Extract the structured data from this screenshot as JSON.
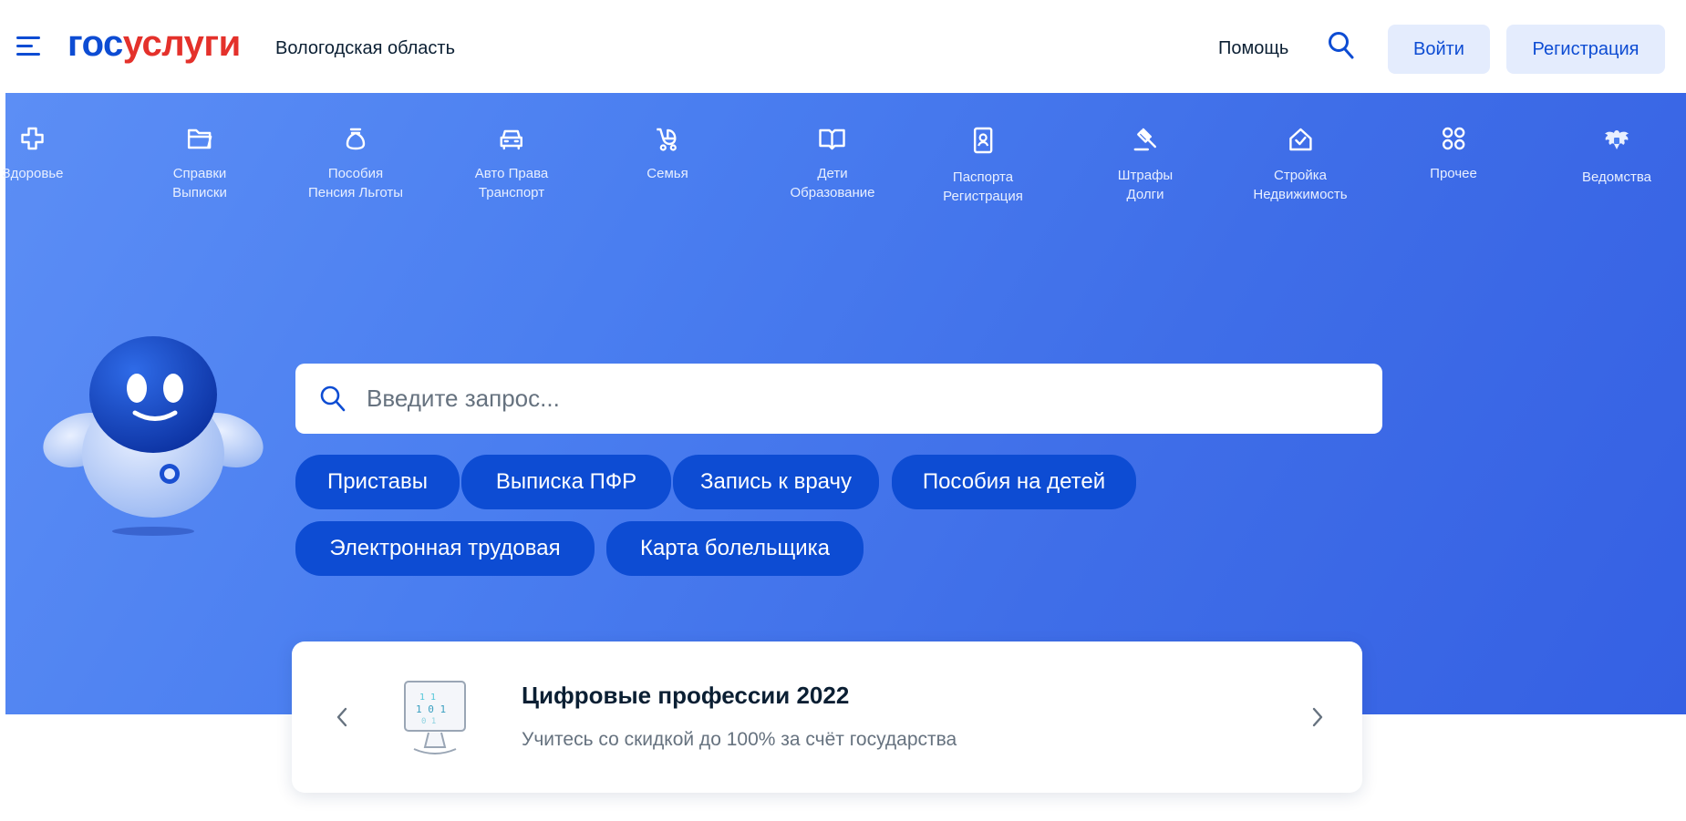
{
  "header": {
    "logo_part1": "гос",
    "logo_part2": "услуги",
    "region": "Вологодская область",
    "help": "Помощь",
    "login": "Войти",
    "register": "Регистрация"
  },
  "categories": [
    {
      "line1": "Здоровье",
      "line2": ""
    },
    {
      "line1": "Справки",
      "line2": "Выписки"
    },
    {
      "line1": "Пособия",
      "line2": "Пенсия Льготы"
    },
    {
      "line1": "Авто Права",
      "line2": "Транспорт"
    },
    {
      "line1": "Семья",
      "line2": ""
    },
    {
      "line1": "Дети",
      "line2": "Образование"
    },
    {
      "line1": "Паспорта",
      "line2": "Регистрация"
    },
    {
      "line1": "Штрафы",
      "line2": "Долги"
    },
    {
      "line1": "Стройка",
      "line2": "Недвижимость"
    },
    {
      "line1": "Прочее",
      "line2": ""
    },
    {
      "line1": "Ведомства",
      "line2": ""
    }
  ],
  "search": {
    "placeholder": "Введите запрос...",
    "chips": [
      "Приставы",
      "Выписка ПФР",
      "Запись к врачу",
      "Пособия на детей",
      "Электронная трудовая",
      "Карта болельщика"
    ]
  },
  "promo": {
    "title": "Цифровые профессии 2022",
    "subtitle": "Учитесь со скидкой до 100% за счёт государства"
  },
  "colors": {
    "brand_blue": "#0d4cd3",
    "brand_red": "#e4312b",
    "hero_bg": "#4a7ef0",
    "button_bg": "#e4ecfd"
  }
}
